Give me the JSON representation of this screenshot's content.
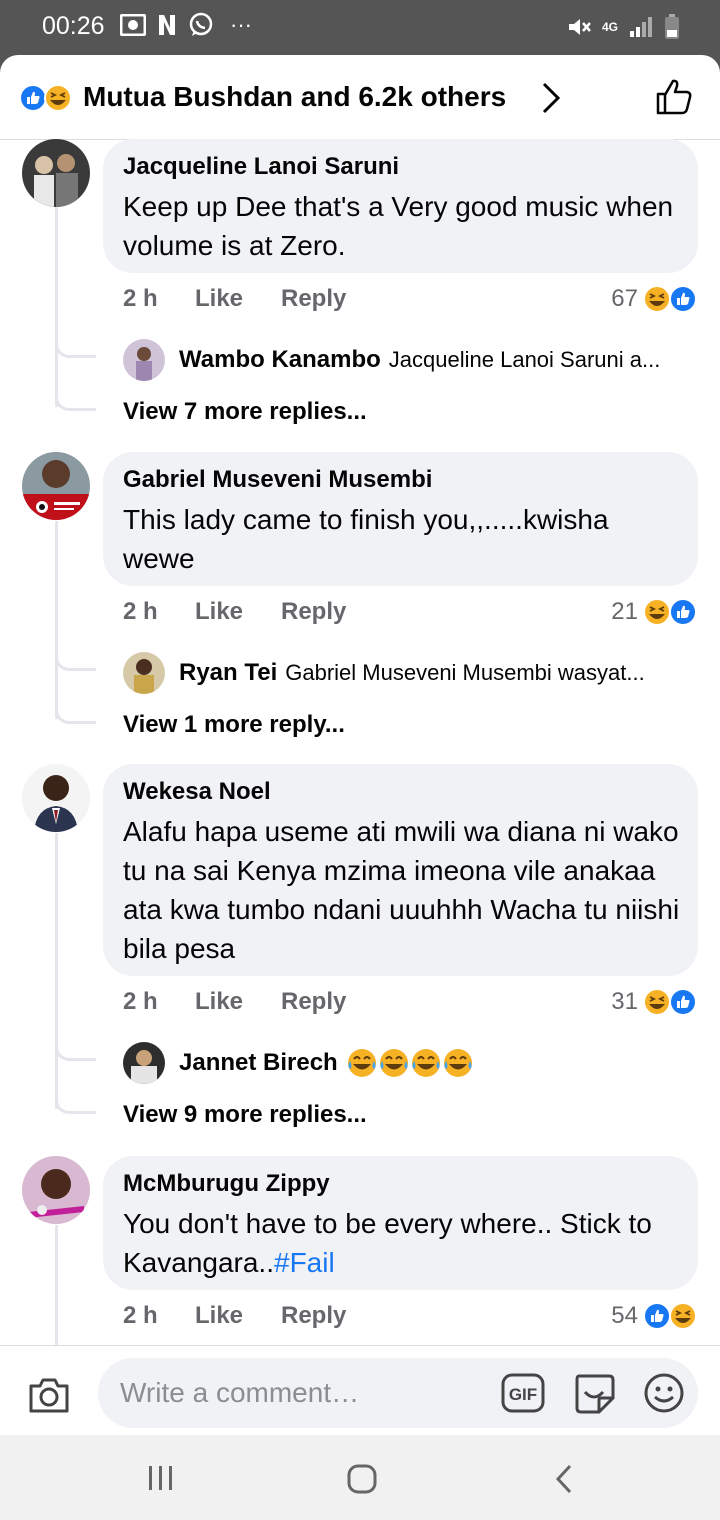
{
  "status_bar": {
    "time": "00:26",
    "overflow": "···",
    "network": "4G"
  },
  "header": {
    "title": "Mutua Bushdan and 6.2k others"
  },
  "comments": [
    {
      "name": "Jacqueline Lanoi Saruni",
      "text": "Keep up Dee that's a Very good music when volume is at Zero.",
      "time": "2 h",
      "like": "Like",
      "reply": "Reply",
      "count": "67",
      "reply_preview": {
        "name": "Wambo Kanambo",
        "text": "Jacqueline Lanoi Saruni a..."
      },
      "view_more": "View 7 more replies..."
    },
    {
      "name": "Gabriel Museveni Musembi",
      "text": "This lady came to finish you,,.....kwisha wewe",
      "time": "2 h",
      "like": "Like",
      "reply": "Reply",
      "count": "21",
      "reply_preview": {
        "name": "Ryan Tei",
        "text": "Gabriel Museveni Musembi wasyat..."
      },
      "view_more": "View 1 more reply..."
    },
    {
      "name": "Wekesa Noel",
      "text": "Alafu hapa useme ati mwili wa diana ni wako tu na sai Kenya mzima imeona vile anakaa ata kwa tumbo ndani uuuhhh Wacha tu niishi bila pesa",
      "time": "2 h",
      "like": "Like",
      "reply": "Reply",
      "count": "31",
      "reply_preview": {
        "name": "Jannet Birech",
        "text": ""
      },
      "view_more": "View 9 more replies..."
    },
    {
      "name": "McMburugu Zippy",
      "text_main": "You don't have to be every where.. Stick to Kavangara..",
      "text_tag": "#Fail",
      "time": "2 h",
      "like": "Like",
      "reply": "Reply",
      "count": "54"
    }
  ],
  "composer": {
    "placeholder": "Write a comment…",
    "gif": "GIF"
  },
  "colors": {
    "accent": "#1877f2",
    "bubble": "#f0f2f5",
    "haha": "#f7b125"
  }
}
